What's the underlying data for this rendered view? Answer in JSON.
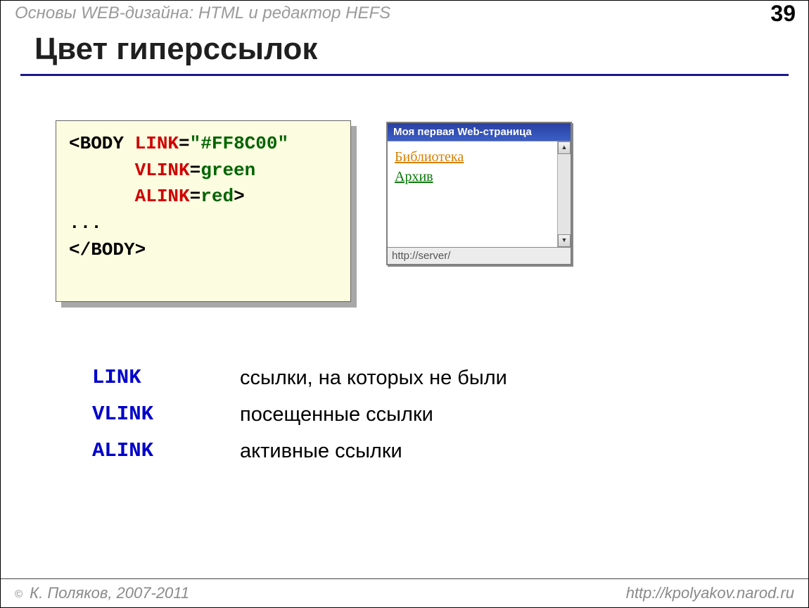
{
  "header": {
    "course_title": "Основы WEB-дизайна: HTML и редактор HEFS",
    "page_number": "39"
  },
  "title": "Цвет гиперссылок",
  "code": {
    "l1_open": "<BODY ",
    "l1_attr": "LINK",
    "l1_eq": "=",
    "l1_val": "\"#FF8C00\"",
    "l2_indent": "      ",
    "l2_attr": "VLINK",
    "l2_eq": "=",
    "l2_val": "green",
    "l3_indent": "      ",
    "l3_attr": "ALINK",
    "l3_eq": "=",
    "l3_val": "red",
    "l3_close": ">",
    "l4": "...",
    "l5": "</BODY>"
  },
  "browser": {
    "title": "Моя первая Web-страница",
    "link1": "Библиотека",
    "link2": "Архив",
    "status": "http://server/",
    "arrow_up": "▲",
    "arrow_down": "▼"
  },
  "definitions": [
    {
      "term": "LINK",
      "desc": "ссылки, на которых не были"
    },
    {
      "term": "VLINK",
      "desc": "посещенные ссылки"
    },
    {
      "term": "ALINK",
      "desc": "активные ссылки"
    }
  ],
  "footer": {
    "copyright_symbol": "©",
    "author": " К. Поляков, 2007-2011",
    "url": "http://kpolyakov.narod.ru"
  }
}
